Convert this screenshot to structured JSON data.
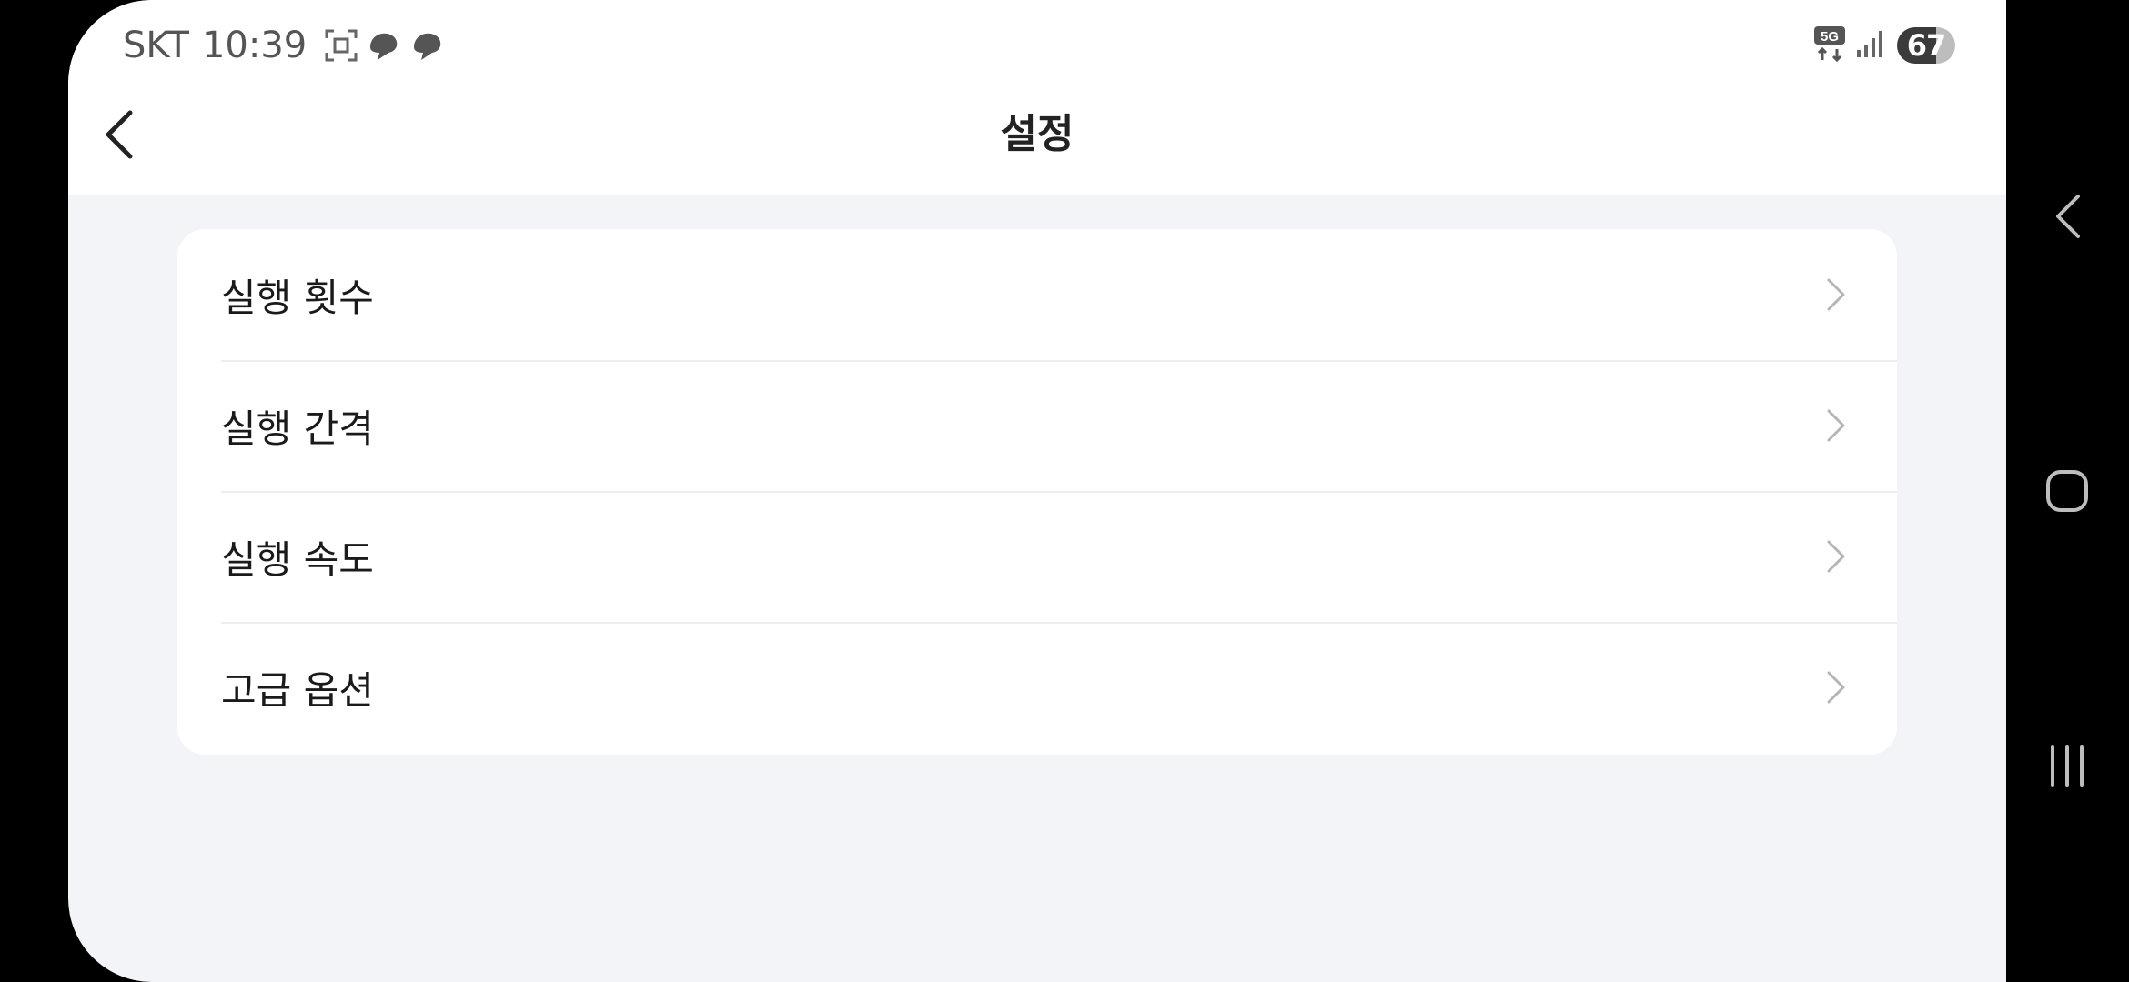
{
  "status_bar": {
    "carrier": "SKT",
    "time": "10:39",
    "network": "5G",
    "battery": "67"
  },
  "header": {
    "title": "설정",
    "back_icon": "chevron-left-icon"
  },
  "settings": {
    "items": [
      {
        "label": "실행 횟수",
        "icon": "chevron-right-icon"
      },
      {
        "label": "실행 간격",
        "icon": "chevron-right-icon"
      },
      {
        "label": "실행 속도",
        "icon": "chevron-right-icon"
      },
      {
        "label": "고급 옵션",
        "icon": "chevron-right-icon"
      }
    ]
  },
  "nav_bar": {
    "buttons": [
      "back-icon",
      "home-icon",
      "recent-apps-icon"
    ]
  },
  "colors": {
    "background": "#f3f4f7",
    "card": "#ffffff",
    "text": "#1a1a1a",
    "chevron": "#b5b5b5"
  }
}
